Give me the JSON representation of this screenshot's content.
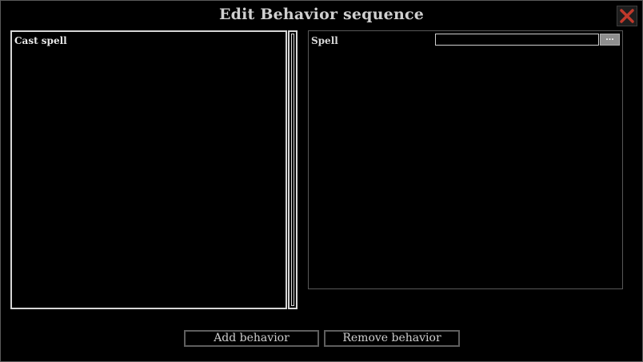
{
  "window": {
    "title": "Edit Behavior sequence",
    "close_icon": "close-x-icon",
    "close_color": "#c0392b"
  },
  "behavior_list": {
    "items": [
      {
        "label": "Cast spell"
      }
    ]
  },
  "properties": {
    "fields": [
      {
        "label": "Spell",
        "value": "",
        "browse_label": "..."
      }
    ]
  },
  "actions": {
    "add_label": "Add behavior",
    "remove_label": "Remove behavior"
  }
}
